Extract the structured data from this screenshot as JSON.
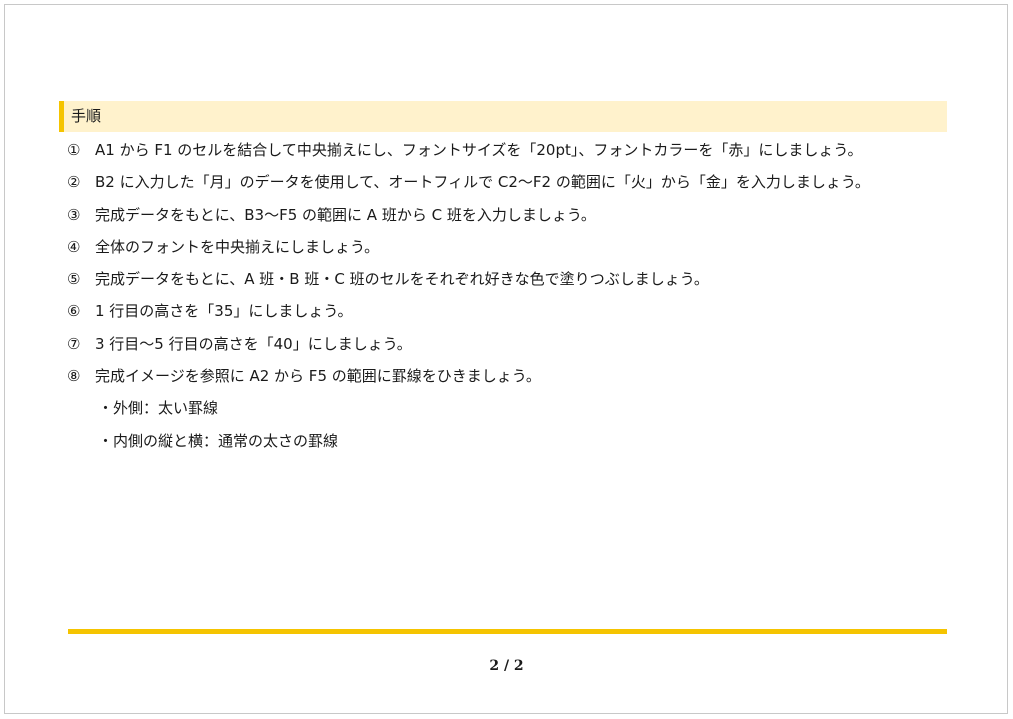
{
  "section": {
    "title": "手順"
  },
  "steps": [
    {
      "num": "①",
      "text": "A1 から F1 のセルを結合して中央揃えにし、フォントサイズを「20pt」、フォントカラーを「赤」にしましょう。"
    },
    {
      "num": "②",
      "text": "B2 に入力した「月」のデータを使用して、オートフィルで C2〜F2 の範囲に「火」から「金」を入力しましょう。"
    },
    {
      "num": "③",
      "text": "完成データをもとに、B3〜F5 の範囲に A 班から C 班を入力しましょう。"
    },
    {
      "num": "④",
      "text": "全体のフォントを中央揃えにしましょう。"
    },
    {
      "num": "⑤",
      "text": "完成データをもとに、A 班・B 班・C 班のセルをそれぞれ好きな色で塗りつぶしましょう。"
    },
    {
      "num": "⑥",
      "text": "1 行目の高さを「35」にしましょう。"
    },
    {
      "num": "⑦",
      "text": "3 行目〜5 行目の高さを「40」にしましょう。"
    },
    {
      "num": "⑧",
      "text": "完成イメージを参照に A2 から F5 の範囲に罫線をひきましょう。"
    }
  ],
  "sub_items": [
    "・外側：太い罫線",
    "・内側の縦と横：通常の太さの罫線"
  ],
  "footer": {
    "page_number": "2 / 2"
  },
  "colors": {
    "accent": "#f5c400",
    "header_background": "#fff2cc"
  }
}
